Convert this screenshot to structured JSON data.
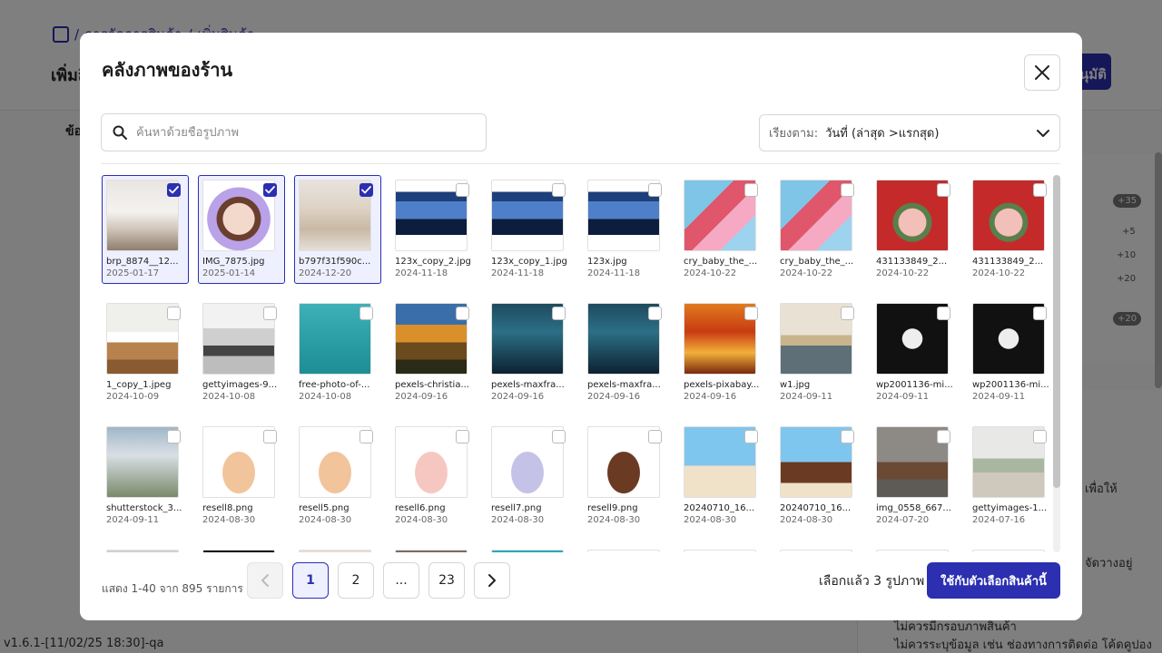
{
  "background": {
    "breadcrumb_home": "/",
    "breadcrumb_1": "การจัดการสินค้า",
    "breadcrumb_sep": "/",
    "breadcrumb_2": "เพิ่มสินค้า",
    "page_title": "เพิ่มสินค้า",
    "primary_button": "อนุมัติ",
    "tab_label": "ข้อ",
    "badges": [
      "+35",
      "+20"
    ],
    "nums": [
      "+5",
      "+10",
      "+20"
    ],
    "right_text_1": "เพื่อให้",
    "right_text_2": "จัดวางอยู่",
    "right_bullet_1": "ไม่ควรมีกรอบภาพสินค้า",
    "right_bullet_2": "ไม่ควรระบุข้อมูล เช่น ช่องทางการติดต่อ โค้ดคูปอง",
    "version": "v1.6.1-[11/02/25 18:30]-qa"
  },
  "modal": {
    "title": "คลังภาพของร้าน",
    "search_placeholder": "ค้นหาด้วยชื่อรูปภาพ",
    "sort_label": "เรียงตาม:",
    "sort_value": "วันที่ (ล่าสุด >แรกสุด)",
    "images": [
      {
        "name": "brp_8874__12...",
        "date": "2025-01-17",
        "selected": true,
        "bg": "linear-gradient(180deg,#e9e6e2 0%,#f4f2ef 45%,#cfc4b8 70%,#8e7e6e 100%)"
      },
      {
        "name": "IMG_7875.jpg",
        "date": "2025-01-14",
        "selected": true,
        "bg": "radial-gradient(circle at 50% 55%,#f3d9cc 0 30%,#6b3f2e 31% 42%,#b9a2e8 43% 60%,#fff 61%)"
      },
      {
        "name": "b797f31f590c...",
        "date": "2024-12-20",
        "selected": true,
        "bg": "linear-gradient(180deg,#e8e3dd 0%,#ddd2c4 40%,#c9b9a6 70%,#e5dfd8 100%)"
      },
      {
        "name": "123x_copy_2.jpg",
        "date": "2024-11-18",
        "selected": false,
        "bg": "linear-gradient(180deg,#fff 0 16%,#1d3f7a 16% 30%,#4f7fc9 30% 55%,#0c1d3d 55% 78%,#fff 78%)"
      },
      {
        "name": "123x_copy_1.jpg",
        "date": "2024-11-18",
        "selected": false,
        "bg": "linear-gradient(180deg,#fff 0 16%,#1d3f7a 16% 30%,#4f7fc9 30% 55%,#0c1d3d 55% 78%,#fff 78%)"
      },
      {
        "name": "123x.jpg",
        "date": "2024-11-18",
        "selected": false,
        "bg": "linear-gradient(180deg,#fff 0 16%,#1d3f7a 16% 30%,#4f7fc9 30% 55%,#0c1d3d 55% 78%,#fff 78%)"
      },
      {
        "name": "cry_baby_the_...",
        "date": "2024-10-22",
        "selected": false,
        "bg": "linear-gradient(135deg,#7fc5e8 0 35%,#e0566a 35% 55%,#f5a9c3 55% 75%,#9ed3ef 75%)"
      },
      {
        "name": "cry_baby_the_...",
        "date": "2024-10-22",
        "selected": false,
        "bg": "linear-gradient(135deg,#7fc5e8 0 35%,#e0566a 35% 55%,#f5a9c3 55% 75%,#9ed3ef 75%)"
      },
      {
        "name": "431133849_2...",
        "date": "2024-10-22",
        "selected": false,
        "bg": "radial-gradient(circle at 50% 60%,#f2c0b8 0 25%,#5a7f4a 26% 35%,#c42a2a 36%)"
      },
      {
        "name": "431133849_2...",
        "date": "2024-10-22",
        "selected": false,
        "bg": "radial-gradient(circle at 50% 60%,#f2c0b8 0 25%,#5a7f4a 26% 35%,#c42a2a 36%)"
      },
      {
        "name": "1_copy_1.jpeg",
        "date": "2024-10-09",
        "selected": false,
        "bg": "linear-gradient(180deg,#efefec 0 40%,#fff 40% 55%,#b8824e 55% 80%,#8a5a30 80%)"
      },
      {
        "name": "gettyimages-9...",
        "date": "2024-10-08",
        "selected": false,
        "bg": "linear-gradient(180deg,#f2f2f2 0 35%,#cfcfcf 35% 60%,#444 60% 75%,#bdbdbd 75%)"
      },
      {
        "name": "free-photo-of-...",
        "date": "2024-10-08",
        "selected": false,
        "bg": "linear-gradient(180deg,#3fb0b8 0%,#2b9ea6 50%,#1f8d95 100%)"
      },
      {
        "name": "pexels-christia...",
        "date": "2024-09-16",
        "selected": false,
        "bg": "linear-gradient(180deg,#3a6ea8 0 30%,#d9902a 30% 55%,#6b4a1e 55% 80%,#2a2a18 80%)"
      },
      {
        "name": "pexels-maxfra...",
        "date": "2024-09-16",
        "selected": false,
        "bg": "linear-gradient(180deg,#1f4a5e 0%,#2c6f86 40%,#0d2230 100%)"
      },
      {
        "name": "pexels-maxfra...",
        "date": "2024-09-16",
        "selected": false,
        "bg": "linear-gradient(180deg,#1f4a5e 0%,#2c6f86 40%,#0d2230 100%)"
      },
      {
        "name": "pexels-pixabay...",
        "date": "2024-09-16",
        "selected": false,
        "bg": "linear-gradient(180deg,#e07a1f 0%,#c83b12 40%,#f3b03a 70%,#7a2a0e 100%)"
      },
      {
        "name": "w1.jpg",
        "date": "2024-09-11",
        "selected": false,
        "bg": "linear-gradient(180deg,#e9e2d4 0 45%,#c9b48c 45% 60%,#5f6f78 60%)"
      },
      {
        "name": "wp2001136-mi...",
        "date": "2024-09-11",
        "selected": false,
        "bg": "radial-gradient(circle at 50% 50%,#eee 0 20%,#111 21%)"
      },
      {
        "name": "wp2001136-mi...",
        "date": "2024-09-11",
        "selected": false,
        "bg": "radial-gradient(circle at 50% 50%,#eee 0 20%,#111 21%)"
      },
      {
        "name": "shutterstock_3...",
        "date": "2024-09-11",
        "selected": false,
        "bg": "linear-gradient(180deg,#9fb7c9 0%,#d9dfe4 40%,#7a8a6a 100%)"
      },
      {
        "name": "resell8.png",
        "date": "2024-08-30",
        "selected": false,
        "bg": "radial-gradient(ellipse at 50% 65%,#f2c49b 0 32%,#fff 33%)"
      },
      {
        "name": "resell5.png",
        "date": "2024-08-30",
        "selected": false,
        "bg": "radial-gradient(ellipse at 50% 65%,#f2c49b 0 32%,#fff 33%)"
      },
      {
        "name": "resell6.png",
        "date": "2024-08-30",
        "selected": false,
        "bg": "radial-gradient(ellipse at 50% 65%,#f6c7c0 0 32%,#fff 33%)"
      },
      {
        "name": "resell7.png",
        "date": "2024-08-30",
        "selected": false,
        "bg": "radial-gradient(ellipse at 50% 65%,#c5c2e8 0 32%,#fff 33%)"
      },
      {
        "name": "resell9.png",
        "date": "2024-08-30",
        "selected": false,
        "bg": "radial-gradient(ellipse at 50% 65%,#6b3a22 0 32%,#fff 33%)"
      },
      {
        "name": "20240710_16...",
        "date": "2024-08-30",
        "selected": false,
        "bg": "linear-gradient(180deg,#7fc6ef 0 55%,#f0e2c8 55%)"
      },
      {
        "name": "20240710_16...",
        "date": "2024-08-30",
        "selected": false,
        "bg": "linear-gradient(180deg,#7fc6ef 0 50%,#6b3a22 50% 80%,#f0e2c8 80%)"
      },
      {
        "name": "img_0558_667...",
        "date": "2024-07-20",
        "selected": false,
        "bg": "linear-gradient(180deg,#8d8a86 0 50%,#6a4a34 50% 75%,#5e5a56 75%)"
      },
      {
        "name": "gettyimages-1...",
        "date": "2024-07-16",
        "selected": false,
        "bg": "linear-gradient(180deg,#e8e8e6 0 45%,#a8b8a0 45% 65%,#cfc8bd 65%)"
      },
      {
        "name": "",
        "date": "",
        "selected": false,
        "bg": "linear-gradient(180deg,#d0d0d0,#f0f0f0)"
      },
      {
        "name": "",
        "date": "",
        "selected": false,
        "bg": "linear-gradient(180deg,#111 0 40%,#fff 40%)"
      },
      {
        "name": "",
        "date": "",
        "selected": false,
        "bg": "linear-gradient(180deg,#e6ddd0,#fff)"
      },
      {
        "name": "",
        "date": "",
        "selected": false,
        "bg": "linear-gradient(180deg,#7a6a5a,#bbb)"
      },
      {
        "name": "",
        "date": "",
        "selected": false,
        "bg": "linear-gradient(180deg,#2aa9b6,#6fd0d8)"
      },
      {
        "name": "",
        "date": "",
        "selected": false,
        "bg": "radial-gradient(circle at 50% 30%,#9ec8e8 0 30%,#fff 31%)"
      },
      {
        "name": "",
        "date": "",
        "selected": false,
        "bg": "radial-gradient(circle at 50% 30%,#9ec8e8 0 30%,#fff 31%)"
      },
      {
        "name": "",
        "date": "",
        "selected": false,
        "bg": "radial-gradient(circle at 50% 30%,#e04040 0 20%,#fff 21%)"
      },
      {
        "name": "",
        "date": "",
        "selected": false,
        "bg": "radial-gradient(circle at 50% 30%,#9ec8e8 0 30%,#fff 31%)"
      },
      {
        "name": "",
        "date": "",
        "selected": false,
        "bg": "radial-gradient(circle at 50% 30%,#e04040 0 20%,#fff 21%)"
      }
    ],
    "footer": {
      "count_text": "แสดง 1-40 จาก 895 รายการ",
      "pages": [
        "1",
        "2",
        "...",
        "23"
      ],
      "selected_text": "เลือกแล้ว 3 รูปภาพ",
      "apply_label": "ใช้กับตัวเลือกสินค้านี้"
    }
  },
  "colors": {
    "accent": "#2b2fb0"
  }
}
